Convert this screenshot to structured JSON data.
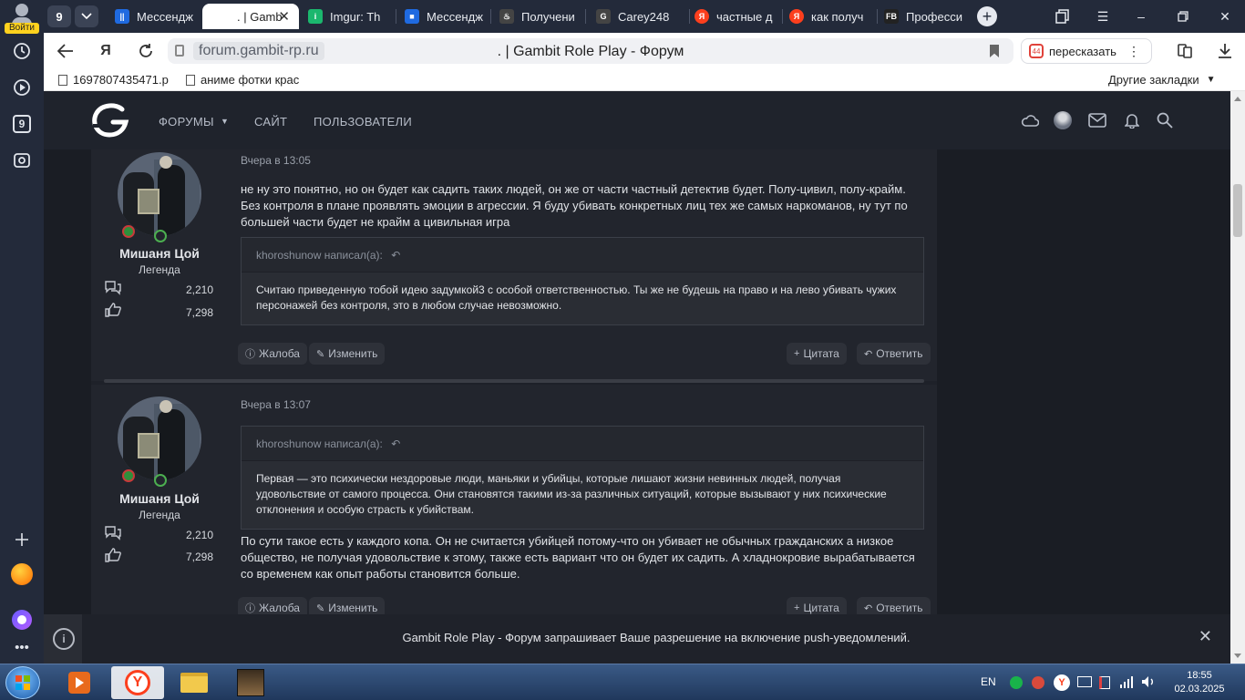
{
  "rail": {
    "login_label": "Войти",
    "workspace_badge": "9",
    "items": [
      "history-icon",
      "play-icon",
      "workspace-9-icon",
      "screenshot-icon",
      "add-icon",
      "mail-app-icon",
      "alice-icon",
      "more-icon"
    ]
  },
  "tabs": {
    "counter": "9",
    "items": [
      {
        "label": "Мессендж",
        "icon_color": "#1f6ae0",
        "icon_text": "||"
      },
      {
        "label": ". | Gamb",
        "icon_color": "#222222",
        "icon_text": "G"
      },
      {
        "label": "Imgur: Th",
        "icon_color": "#1bb76e",
        "icon_text": "i"
      },
      {
        "label": "Мессендж",
        "icon_color": "#1f6ae0",
        "icon_text": "■"
      },
      {
        "label": "Получени",
        "icon_color": "#444444",
        "icon_text": "♨"
      },
      {
        "label": "Carey248",
        "icon_color": "#444444",
        "icon_text": "G"
      },
      {
        "label": "частные д",
        "icon_color": "#fc3f1d",
        "icon_text": "Я"
      },
      {
        "label": "как получ",
        "icon_color": "#fc3f1d",
        "icon_text": "Я"
      },
      {
        "label": "Професси",
        "icon_color": "#222222",
        "icon_text": "FB"
      }
    ]
  },
  "address": {
    "domain": "forum.gambit-rp.ru",
    "page_title": ". | Gambit Role Play - Форум",
    "retell_label": "пересказать"
  },
  "bookmarks": {
    "items": [
      "1697807435471.p",
      "аниме фотки крас"
    ],
    "other": "Другие закладки"
  },
  "forum_nav": {
    "items": [
      "ФОРУМЫ",
      "САЙТ",
      "ПОЛЬЗОВАТЕЛИ"
    ]
  },
  "posts": [
    {
      "user": "Мишаня Цой",
      "rank": "Легенда",
      "messages": "2,210",
      "reactions": "7,298",
      "date": "Вчера в 13:05",
      "text": "не ну это понятно, но он будет как садить таких людей, он же от части частный детектив будет. Полу-цивил, полу-крайм. Без контроля в плане проявлять эмоции в агрессии. Я буду убивать конкретных лиц тех же самых наркоманов, ну тут по большей части будет не крайм а цивильная игра",
      "quote_author": "khoroshunow написал(а):",
      "quote_text": "Считаю приведенную тобой идею задумкой3 с особой ответственностью. Ты же не будешь на право и на лево убивать чужих персонажей без контроля, это в любом случае невозможно."
    },
    {
      "user": "Мишаня Цой",
      "rank": "Легенда",
      "messages": "2,210",
      "reactions": "7,298",
      "date": "Вчера в 13:07",
      "quote_author": "khoroshunow написал(а):",
      "quote_text": "Первая — это психически нездоровые люди, маньяки и убийцы, которые лишают жизни невинных людей, получая удовольствие от самого процесса. Они становятся такими из-за различных ситуаций, которые вызывают у них психические отклонения и особую страсть к убийствам.",
      "text": "По сути такое есть у каждого копа. Он не считается убийцей потому-что он убивает не обычных гражданских а низкое общество, не получая удовольствие к этому, также есть вариант что он будет их садить. А хладнокровие вырабатывается со временем как опыт работы становится больше."
    }
  ],
  "post_actions": {
    "report": "Жалоба",
    "edit": "Изменить",
    "quote": "Цитата",
    "reply": "Ответить"
  },
  "notification": {
    "message": "Gambit Role Play - Форум запрашивает Ваше разрешение на включение push-уведомлений."
  },
  "taskbar": {
    "lang": "EN",
    "time": "18:55",
    "date": "02.03.2025"
  }
}
